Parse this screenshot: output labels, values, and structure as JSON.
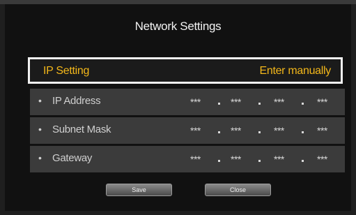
{
  "dialog": {
    "title": "Network Settings"
  },
  "ip_setting": {
    "label": "IP Setting",
    "value": "Enter manually"
  },
  "rows": [
    {
      "bullet": "•",
      "label": "IP Address",
      "octets": [
        "***",
        "***",
        "***",
        "***"
      ]
    },
    {
      "bullet": "•",
      "label": "Subnet Mask",
      "octets": [
        "***",
        "***",
        "***",
        "***"
      ]
    },
    {
      "bullet": "•",
      "label": "Gateway",
      "octets": [
        "***",
        "***",
        "***",
        "***"
      ]
    }
  ],
  "buttons": {
    "save": "Save",
    "close": "Close"
  },
  "colors": {
    "accent": "#f3b71a",
    "panel": "#111111",
    "row": "#3b3b3b"
  }
}
